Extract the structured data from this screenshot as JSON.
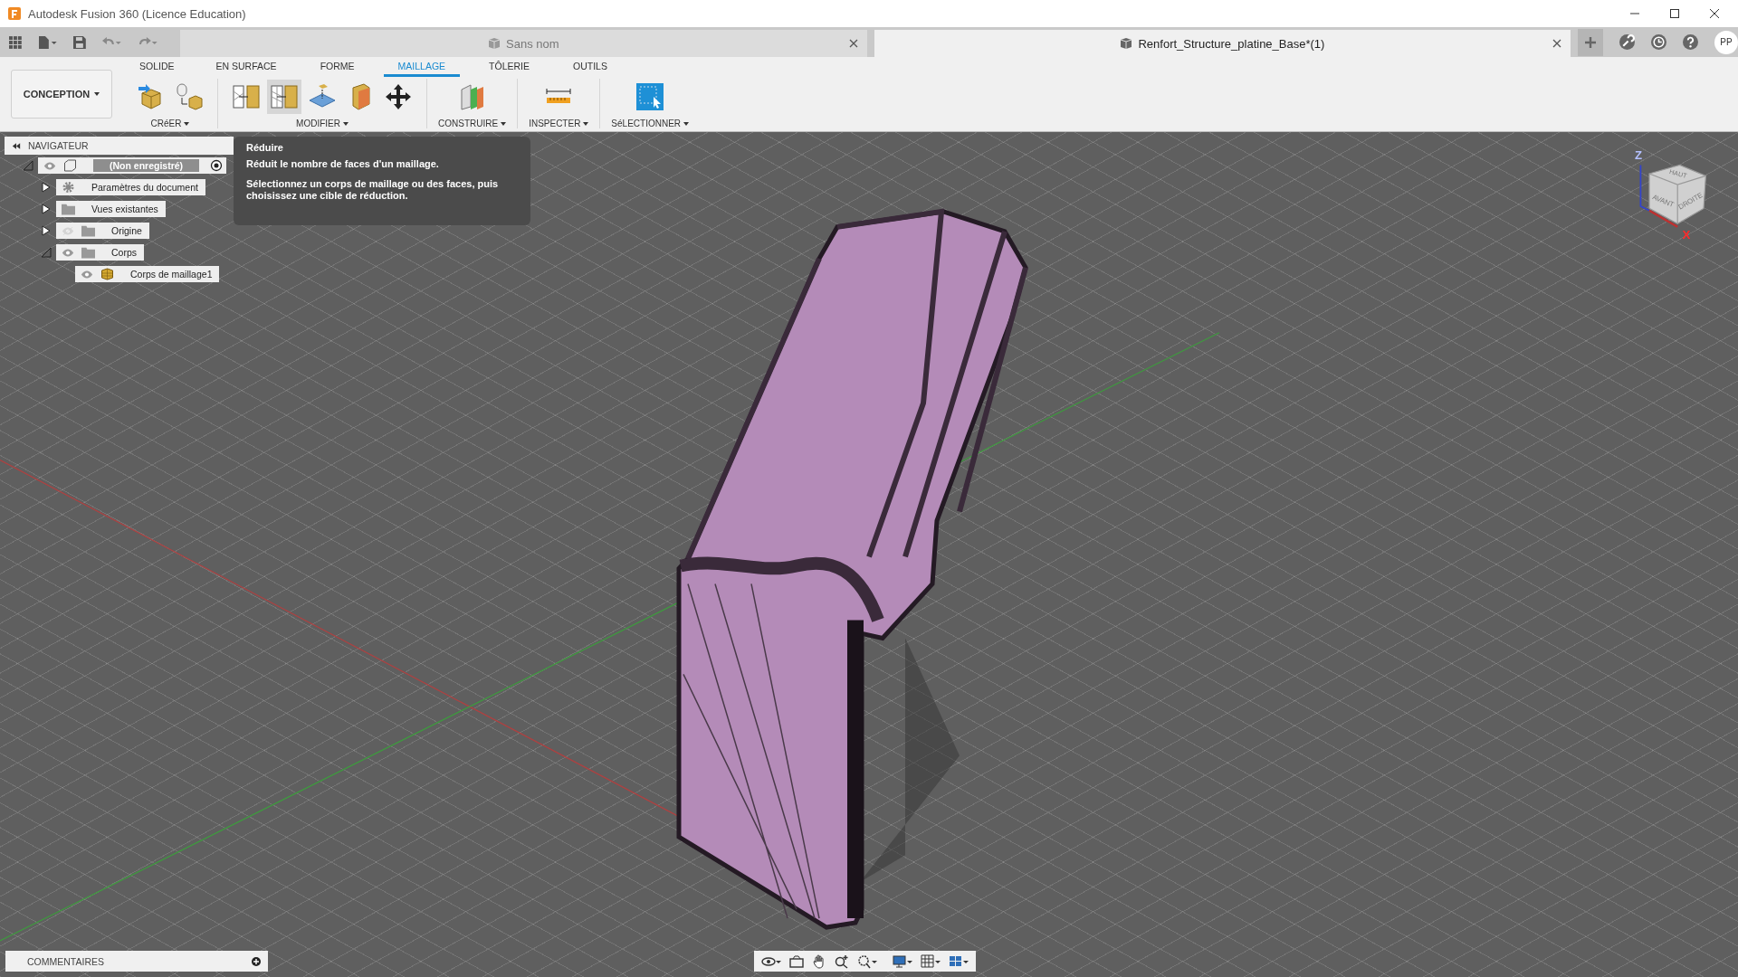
{
  "window": {
    "title": "Autodesk Fusion 360 (Licence Education)"
  },
  "tabs": [
    {
      "label": "Sans nom",
      "selected": false
    },
    {
      "label": "Renfort_Structure_platine_Base*(1)",
      "selected": true
    }
  ],
  "user_badge": "PP",
  "workspace": "CONCEPTION",
  "ribbon_tabs": [
    {
      "label": "SOLIDE",
      "selected": false
    },
    {
      "label": "EN SURFACE",
      "selected": false
    },
    {
      "label": "FORME",
      "selected": false
    },
    {
      "label": "MAILLAGE",
      "selected": true
    },
    {
      "label": "TÔLERIE",
      "selected": false
    },
    {
      "label": "OUTILS",
      "selected": false
    }
  ],
  "groups": [
    {
      "label": "CRéER",
      "tools": [
        {
          "kind": "box",
          "selected": false
        },
        {
          "kind": "convert",
          "selected": false
        }
      ]
    },
    {
      "label": "MODIFIER",
      "tools": [
        {
          "kind": "remesh",
          "selected": false
        },
        {
          "kind": "reduce",
          "selected": true
        },
        {
          "kind": "plane-cut",
          "selected": false
        },
        {
          "kind": "face-group",
          "selected": false
        },
        {
          "kind": "move",
          "selected": false
        }
      ]
    },
    {
      "label": "CONSTRUIRE",
      "tools": [
        {
          "kind": "plane",
          "selected": false
        }
      ]
    },
    {
      "label": "INSPECTER",
      "tools": [
        {
          "kind": "measure",
          "selected": false
        }
      ]
    },
    {
      "label": "SéLECTIONNER",
      "tools": [
        {
          "kind": "select",
          "selected": false
        }
      ]
    }
  ],
  "navigator": {
    "title": "NAVIGATEUR",
    "tree": [
      {
        "label": "(Non enregistré)",
        "kind": "document",
        "visible": true,
        "expanded": true,
        "children": [
          {
            "label": "Paramètres du document",
            "kind": "settings",
            "expanded": false
          },
          {
            "label": "Vues existantes",
            "kind": "folder",
            "expanded": false
          },
          {
            "label": "Origine",
            "kind": "folder",
            "visible": false,
            "expanded": false
          },
          {
            "label": "Corps",
            "kind": "folder",
            "visible": true,
            "expanded": true,
            "children": [
              {
                "label": "Corps de maillage1",
                "kind": "mesh",
                "visible": true
              }
            ]
          }
        ]
      }
    ]
  },
  "tooltip": {
    "title": "Réduire",
    "description": "Réduit le nombre de faces d'un maillage.",
    "instruction": "Sélectionnez un corps de maillage ou des faces, puis choisissez une cible de réduction."
  },
  "viewcube": {
    "faces": [
      "HAUT",
      "AVANT",
      "DROITE"
    ],
    "axes": [
      "Z",
      "X"
    ]
  },
  "comments": {
    "label": "COMMENTAIRES"
  }
}
